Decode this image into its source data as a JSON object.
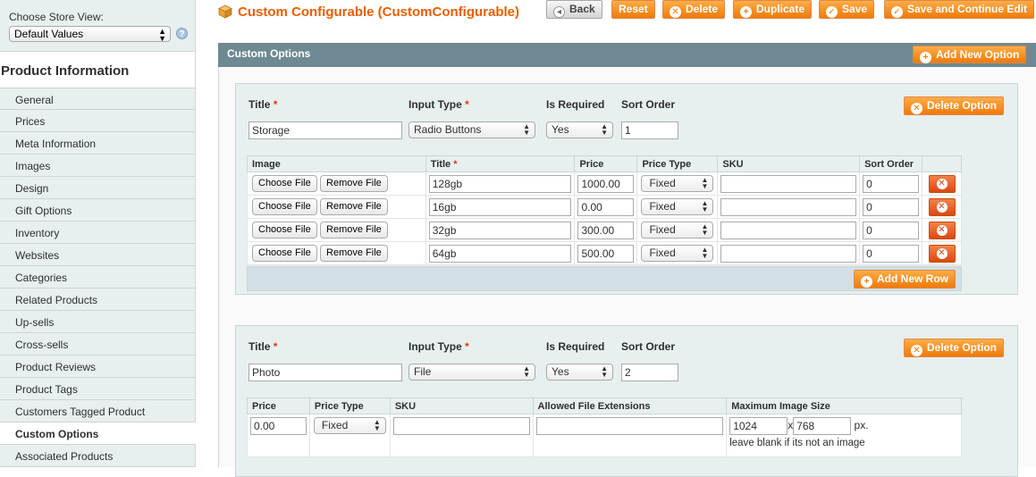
{
  "store_switcher": {
    "label": "Choose Store View:",
    "value": "Default Values",
    "help_icon": "question-icon"
  },
  "sidebar": {
    "title": "Product Information",
    "tabs": [
      {
        "label": "General"
      },
      {
        "label": "Prices"
      },
      {
        "label": "Meta Information"
      },
      {
        "label": "Images"
      },
      {
        "label": "Design"
      },
      {
        "label": "Gift Options"
      },
      {
        "label": "Inventory"
      },
      {
        "label": "Websites"
      },
      {
        "label": "Categories"
      },
      {
        "label": "Related Products"
      },
      {
        "label": "Up-sells"
      },
      {
        "label": "Cross-sells"
      },
      {
        "label": "Product Reviews"
      },
      {
        "label": "Product Tags"
      },
      {
        "label": "Customers Tagged Product"
      },
      {
        "label": "Custom Options",
        "active": true
      },
      {
        "label": "Associated Products"
      }
    ]
  },
  "header": {
    "title": "Custom Configurable (CustomConfigurable)",
    "buttons": {
      "back": "Back",
      "reset": "Reset",
      "delete": "Delete",
      "duplicate": "Duplicate",
      "save": "Save",
      "save_continue": "Save and Continue Edit"
    }
  },
  "custom_options": {
    "section_title": "Custom Options",
    "add_new_option": "Add New Option",
    "labels": {
      "title": "Title",
      "input_type": "Input Type",
      "is_required": "Is Required",
      "sort_order": "Sort Order",
      "required_mark": "*",
      "delete_option": "Delete Option",
      "add_new_row": "Add New Row"
    },
    "option1": {
      "title": "Storage",
      "input_type": "Radio Buttons",
      "is_required": "Yes",
      "sort_order": "1",
      "columns": {
        "image": "Image",
        "title": "Title",
        "price": "Price",
        "price_type": "Price Type",
        "sku": "SKU",
        "sort_order": "Sort Order"
      },
      "choose_file": "Choose File",
      "remove_file": "Remove File",
      "rows": [
        {
          "title": "128gb",
          "price": "1000.00",
          "price_type": "Fixed",
          "sku": "",
          "sort_order": "0"
        },
        {
          "title": "16gb",
          "price": "0.00",
          "price_type": "Fixed",
          "sku": "",
          "sort_order": "0"
        },
        {
          "title": "32gb",
          "price": "300.00",
          "price_type": "Fixed",
          "sku": "",
          "sort_order": "0"
        },
        {
          "title": "64gb",
          "price": "500.00",
          "price_type": "Fixed",
          "sku": "",
          "sort_order": "0"
        }
      ]
    },
    "option2": {
      "title": "Photo",
      "input_type": "File",
      "is_required": "Yes",
      "sort_order": "2",
      "columns": {
        "price": "Price",
        "price_type": "Price Type",
        "sku": "SKU",
        "allowed_ext": "Allowed File Extensions",
        "max_size": "Maximum Image Size"
      },
      "price": "0.00",
      "price_type": "Fixed",
      "sku": "",
      "allowed_ext": "",
      "max_width": "1024",
      "size_separator": "x",
      "max_height": "768",
      "unit": "px.",
      "hint": "leave blank if its not an image"
    }
  },
  "icons": {
    "header": "product-box-icon",
    "accent": "#eb5e00",
    "button_gradient": [
      "#ffac47",
      "#f07a0a"
    ],
    "section_header": "#6f8992",
    "panel_bg": "#e7efef"
  }
}
